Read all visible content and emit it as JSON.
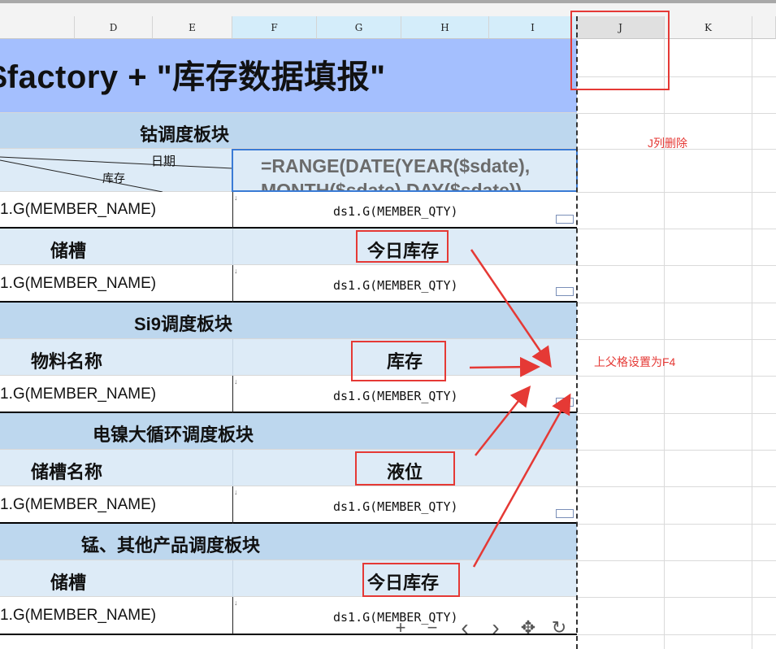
{
  "columns": [
    "D",
    "E",
    "F",
    "G",
    "H",
    "I",
    "J",
    "K"
  ],
  "title": "$factory + \"库存数据填报\"",
  "formula_line1": "=RANGE(DATE(YEAR($sdate),",
  "formula_line2": "MONTH($sdate),DAY($sdate))",
  "diag_header": {
    "top": "日期",
    "bottom": "库存"
  },
  "sections": [
    {
      "title": "钴调度板块"
    },
    {
      "title": "Si9调度板块"
    },
    {
      "title": "电镍大循环调度板块"
    },
    {
      "title": "锰、其他产品调度板块"
    }
  ],
  "subheaders": [
    {
      "left": "储槽",
      "right": "今日库存"
    },
    {
      "left": "物料名称",
      "right": "库存"
    },
    {
      "left": "储槽名称",
      "right": "液位"
    },
    {
      "left": "储槽",
      "right": "今日库存"
    }
  ],
  "member_name": "1.G(MEMBER_NAME)",
  "member_qty": "ds1.G(MEMBER_QTY)",
  "annotations": {
    "delete_col": "J列删除",
    "parent_cell": "上父格设置为F4"
  },
  "toolbar": {
    "zoom_in": "+",
    "zoom_out": "−",
    "prev": "‹",
    "next": "›",
    "move": "✥",
    "redo": "↻"
  },
  "colors": {
    "title_bg": "#a4bffe",
    "section_bg": "#bdd7ee",
    "light_bg": "#ddebf7",
    "annotation_red": "#e53935",
    "selection_blue": "#3a7bd5"
  }
}
